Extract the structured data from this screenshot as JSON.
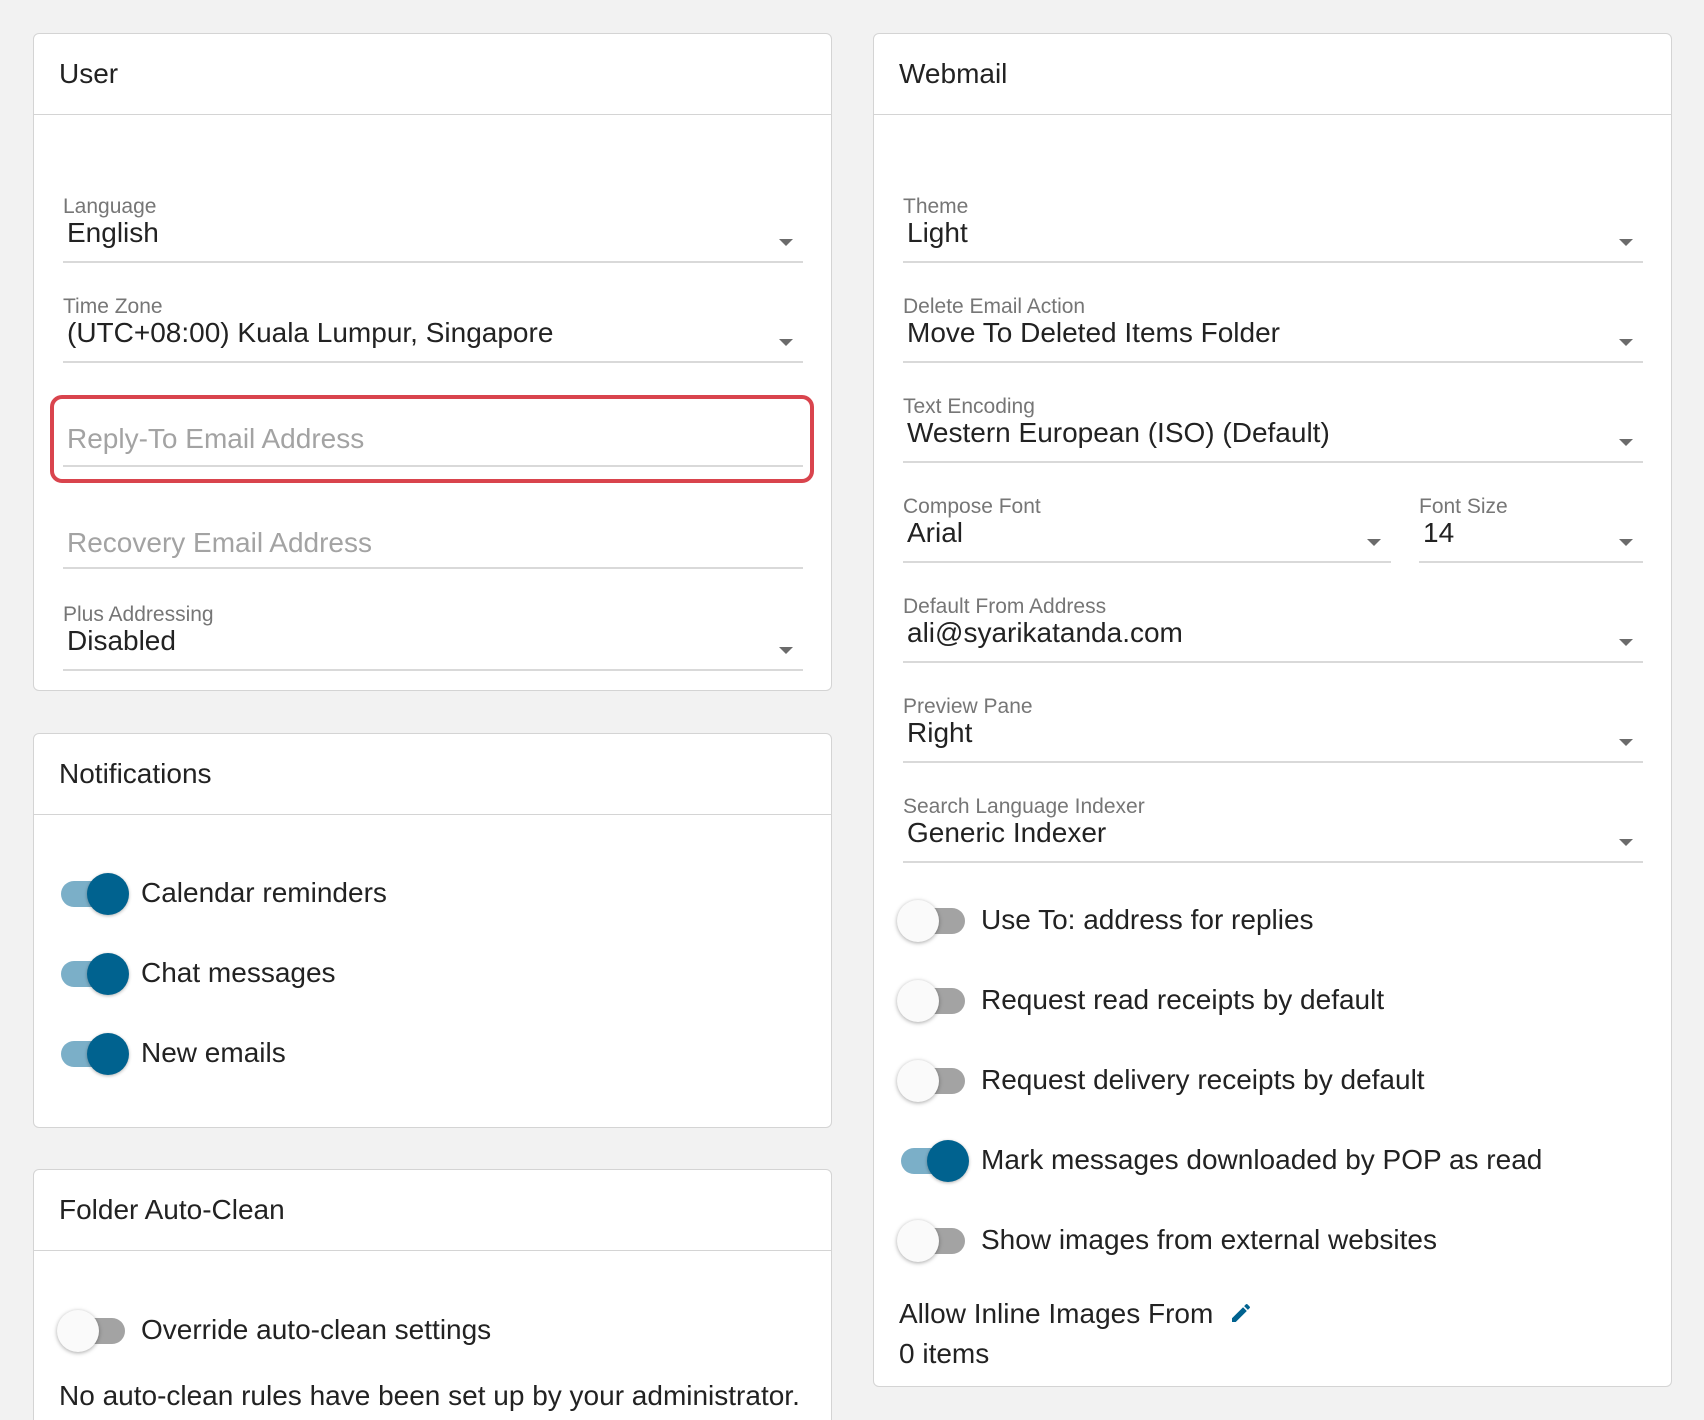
{
  "user": {
    "title": "User",
    "language": {
      "label": "Language",
      "value": "English"
    },
    "time_zone": {
      "label": "Time Zone",
      "value": "(UTC+08:00) Kuala Lumpur, Singapore"
    },
    "reply_to": {
      "placeholder": "Reply-To Email Address"
    },
    "recovery": {
      "placeholder": "Recovery Email Address"
    },
    "plus_addressing": {
      "label": "Plus Addressing",
      "value": "Disabled"
    }
  },
  "notifications": {
    "title": "Notifications",
    "items": [
      {
        "label": "Calendar reminders",
        "on": true
      },
      {
        "label": "Chat messages",
        "on": true
      },
      {
        "label": "New emails",
        "on": true
      }
    ]
  },
  "folder_autoclean": {
    "title": "Folder Auto-Clean",
    "override": {
      "label": "Override auto-clean settings",
      "on": false
    },
    "note": "No auto-clean rules have been set up by your administrator."
  },
  "webmail": {
    "title": "Webmail",
    "theme": {
      "label": "Theme",
      "value": "Light"
    },
    "delete_action": {
      "label": "Delete Email Action",
      "value": "Move To Deleted Items Folder"
    },
    "text_encoding": {
      "label": "Text Encoding",
      "value": "Western European (ISO) (Default)"
    },
    "compose_font": {
      "label": "Compose Font",
      "value": "Arial"
    },
    "font_size": {
      "label": "Font Size",
      "value": "14"
    },
    "default_from": {
      "label": "Default From Address",
      "value": "ali@syarikatanda.com"
    },
    "preview_pane": {
      "label": "Preview Pane",
      "value": "Right"
    },
    "search_indexer": {
      "label": "Search Language Indexer",
      "value": "Generic Indexer"
    },
    "toggles": [
      {
        "label": "Use To: address for replies",
        "on": false
      },
      {
        "label": "Request read receipts by default",
        "on": false
      },
      {
        "label": "Request delivery receipts by default",
        "on": false
      },
      {
        "label": "Mark messages downloaded by POP as read",
        "on": true
      },
      {
        "label": "Show images from external websites",
        "on": false
      }
    ],
    "inline_images": {
      "label": "Allow Inline Images From",
      "count": "0 items",
      "icon": "pencil-icon"
    }
  },
  "colors": {
    "accent": "#00628f",
    "highlight": "#d9444d"
  }
}
